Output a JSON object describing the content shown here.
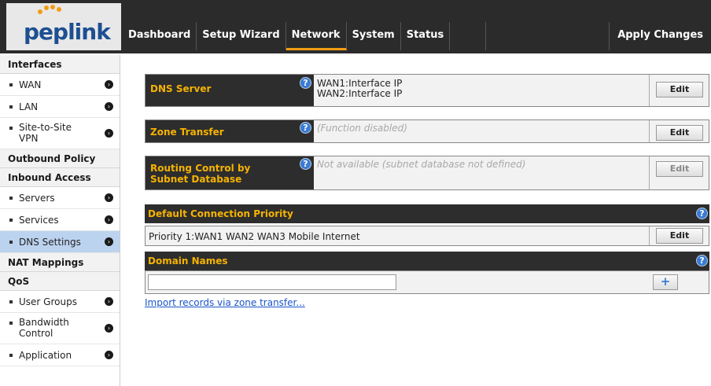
{
  "brand": {
    "logo_text": "peplink"
  },
  "nav": {
    "items": [
      "Dashboard",
      "Setup Wizard",
      "Network",
      "System",
      "Status"
    ],
    "active": "Network",
    "apply_label": "Apply Changes"
  },
  "sidebar": {
    "interfaces_header": "Interfaces",
    "wan": "WAN",
    "lan": "LAN",
    "site_to_site_vpn": "Site-to-Site VPN",
    "outbound_policy": "Outbound Policy",
    "inbound_access": "Inbound Access",
    "servers": "Servers",
    "services": "Services",
    "dns_settings": "DNS Settings",
    "nat_mappings": "NAT Mappings",
    "qos": "QoS",
    "user_groups": "User Groups",
    "bandwidth_control": "Bandwidth Control",
    "application": "Application"
  },
  "dns_server": {
    "label": "DNS Server",
    "value_line1": "WAN1:Interface IP",
    "value_line2": "WAN2:Interface IP",
    "edit_label": "Edit"
  },
  "zone_transfer": {
    "label": "Zone Transfer",
    "value": "(Function disabled)",
    "edit_label": "Edit"
  },
  "routing_control": {
    "label_line1": "Routing Control by",
    "label_line2": "Subnet Database",
    "value": "Not available (subnet database not defined)",
    "edit_label": "Edit"
  },
  "default_priority": {
    "header": "Default Connection Priority",
    "value": "Priority 1:WAN1 WAN2 WAN3 Mobile Internet",
    "edit_label": "Edit"
  },
  "domain_names": {
    "header": "Domain Names",
    "input_value": "",
    "add_label": "+"
  },
  "import_link": "Import records via zone transfer...",
  "help_glyph": "?",
  "arrow_glyph": "›",
  "colors": {
    "accent": "#f39c12",
    "header_text": "#f5b301",
    "dark_bg": "#2d2d2d",
    "active_sidebar": "#bcd3ef",
    "link": "#1a55c9"
  }
}
